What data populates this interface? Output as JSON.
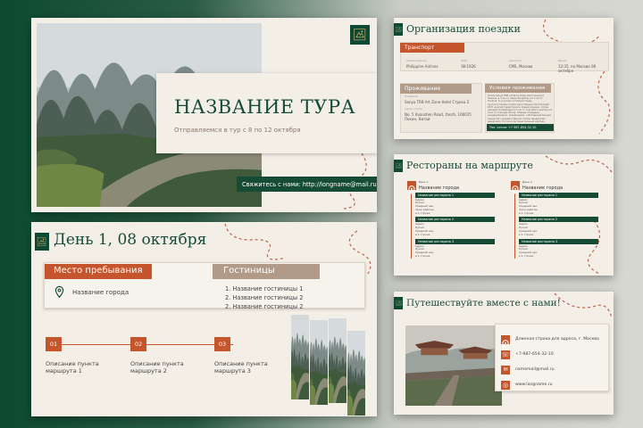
{
  "slide1": {
    "title": "НАЗВАНИЕ ТУРА",
    "subtitle": "Отправляемся в тур с 8 по 12 октября",
    "contact": "Свяжитесь с нами: http://longname@mail.ru"
  },
  "slide2": {
    "title": "Организация поездки",
    "transport_label": "Транспорт",
    "flight": [
      {
        "k": "Авиакомпания",
        "v": "Philippine Airlines"
      },
      {
        "k": "Рейс",
        "v": "SK-1926"
      },
      {
        "k": "Аэропорт",
        "v": "CMS, Москва"
      },
      {
        "k": "Время",
        "v": "12:35, по Москве 08 октября"
      }
    ],
    "stay_label": "Проживание",
    "stay_name": "Название",
    "stay_name_v": "Sanya TRB Art Zone Hotel Строка 2",
    "stay_addr": "Адрес отеля",
    "stay_addr_v": "No. 5 Xuanzhen Road, Yanzh, 100015 Пекин, Китай",
    "cond_label": "Условия проживания",
    "cond_text": "Отель Sanya TRB Art Zone Hotel расположен в Пекине, в 3 км от парка Kungfeng и в 3 км от Tianhua. К услугам гостей ресторан, круглосуточная стойка регистрации, бесплатный Wi-Fi на всей территории и общий лаундж. Отель находится примерно в 3 км от торгового центра и в 4 км от станции Zhong. Номера оснащены кондиционером, телевизором, собственной ванной комнатой с душем и феном. Отель предлагает шведский стол или континентальный завтрак.",
    "phone": "Тел. отеля: +7 987-654-32-10"
  },
  "slide3": {
    "title": "Рестораны на маршруте",
    "columns": [
      {
        "day": "День 1",
        "city": "Название города",
        "items": [
          {
            "name": "Название ресторана 1",
            "info": [
              "Адрес:",
              "Кухня:",
              "Средний чек:",
              "Часы работы:",
              "в 1 строке"
            ]
          },
          {
            "name": "Название ресторана 2",
            "info": [
              "Адрес:",
              "Кухня:",
              "Средний чек:",
              "в 1 строке"
            ]
          },
          {
            "name": "Название ресторана 3",
            "info": [
              "Адрес:",
              "Кухня:",
              "Средний чек:",
              "в 1 строке"
            ]
          }
        ]
      },
      {
        "day": "День 2",
        "city": "Название города",
        "items": [
          {
            "name": "Название ресторана 1",
            "info": [
              "Адрес:",
              "Кухня:",
              "Средний чек:",
              "Часы работы:",
              "в 1 строке"
            ]
          },
          {
            "name": "Название ресторана 2",
            "info": [
              "Адрес:",
              "Кухня:",
              "Средний чек:",
              "в 1 строке"
            ]
          },
          {
            "name": "Название ресторана 3",
            "info": [
              "Адрес:",
              "Кухня:",
              "Средний чек:",
              "в 1 строке"
            ]
          }
        ]
      }
    ]
  },
  "slide4": {
    "title": "День 1, 08 октября",
    "place_label": "Место пребывания",
    "city": "Название города",
    "hotels_label": "Гостиницы",
    "hotels": [
      "1. Название гостиницы 1",
      "2. Название гостиницы 2",
      "2. Название гостиницы 2"
    ],
    "steps": [
      {
        "num": "01",
        "text": "Описание пункта маршрута 1"
      },
      {
        "num": "02",
        "text": "Описание пункта маршрута 2"
      },
      {
        "num": "03",
        "text": "Описание пункта маршрута 3"
      }
    ]
  },
  "slide5": {
    "title": "Путешествуйте вместе с нами!",
    "contacts": [
      {
        "icon": "location-pin-icon",
        "text": "Длинная строка для адреса, г. Москва"
      },
      {
        "icon": "phone-icon",
        "text": "+7-987-654-32-10"
      },
      {
        "icon": "mail-icon",
        "text": "namemail@mail.ru"
      },
      {
        "icon": "globe-icon",
        "text": "www.longname.ru"
      }
    ]
  },
  "colors": {
    "accent": "#c4552c",
    "green": "#0e4a33",
    "tan": "#b19a87",
    "bg": "#f3eee6"
  }
}
